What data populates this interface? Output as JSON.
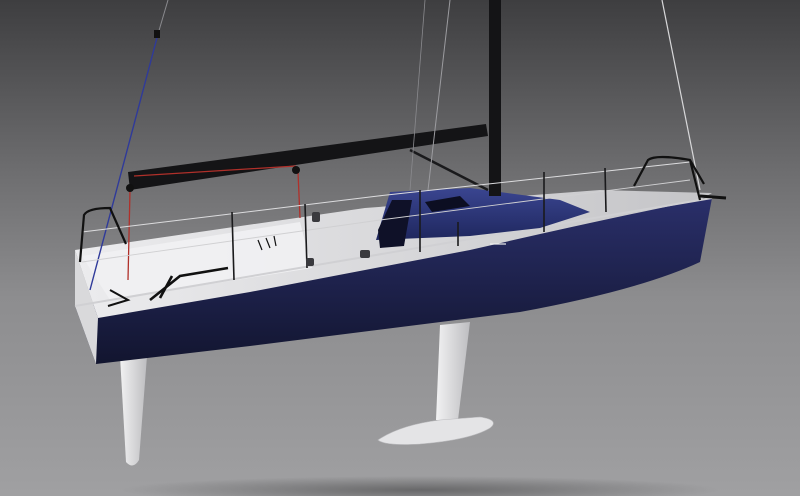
{
  "scene": {
    "subject": "sailboat-render",
    "colors": {
      "background_top": "#3e3e40",
      "background_bottom": "#a0a0a2",
      "hull": "#1b1f4a",
      "deck": "#d7d7d9",
      "cabin": "#2a3578",
      "mast": "#141416",
      "appendages": "#e6e6e8",
      "mainsheet": "#b0302a",
      "backstay": "#2f3a9a"
    }
  }
}
